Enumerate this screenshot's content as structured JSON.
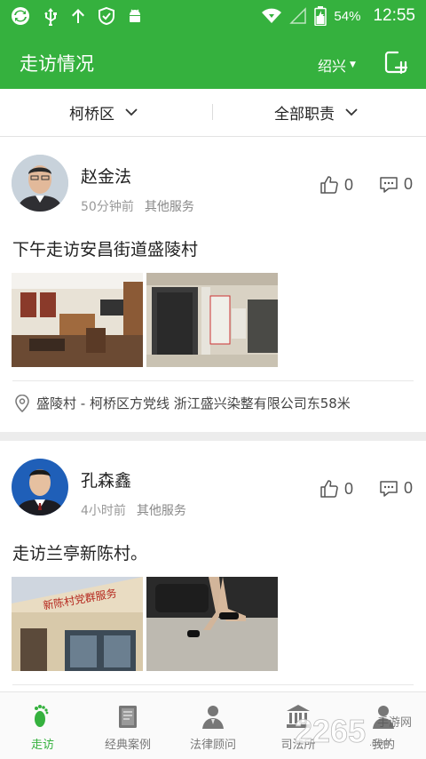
{
  "status_bar": {
    "battery": "54%",
    "time": "12:55",
    "icons": [
      "sync-icon",
      "usb-icon",
      "upload-icon",
      "shield-icon",
      "android-icon",
      "wifi-icon",
      "signal-icon",
      "battery-icon"
    ]
  },
  "header": {
    "title": "走访情况",
    "city": "绍兴",
    "add_icon": "add-post-icon"
  },
  "filters": {
    "district": "柯桥区",
    "duty": "全部职责"
  },
  "posts": [
    {
      "name": "赵金法",
      "time": "50分钟前",
      "category": "其他服务",
      "likes": "0",
      "comments": "0",
      "content": "下午走访安昌街道盛陵村",
      "location": "盛陵村 - 柯桥区方党线 浙江盛兴染整有限公司东58米"
    },
    {
      "name": "孔森鑫",
      "time": "4小时前",
      "category": "其他服务",
      "likes": "0",
      "comments": "0",
      "content": "走访兰亭新陈村。",
      "sign_text": "新陈村党群服务"
    }
  ],
  "tabs": [
    {
      "label": "走访",
      "icon": "footprint-icon",
      "active": true
    },
    {
      "label": "经典案例",
      "icon": "book-icon",
      "active": false
    },
    {
      "label": "法律顾问",
      "icon": "lawyer-icon",
      "active": false
    },
    {
      "label": "司法所",
      "icon": "courthouse-icon",
      "active": false
    },
    {
      "label": "我的",
      "icon": "profile-icon",
      "active": false
    }
  ],
  "watermark": {
    "text": "2265",
    "suffix": "手游网",
    "domain": ".com"
  },
  "colors": {
    "brand_green": "#35b13e",
    "background": "#ffffff",
    "separator": "#ececec"
  }
}
